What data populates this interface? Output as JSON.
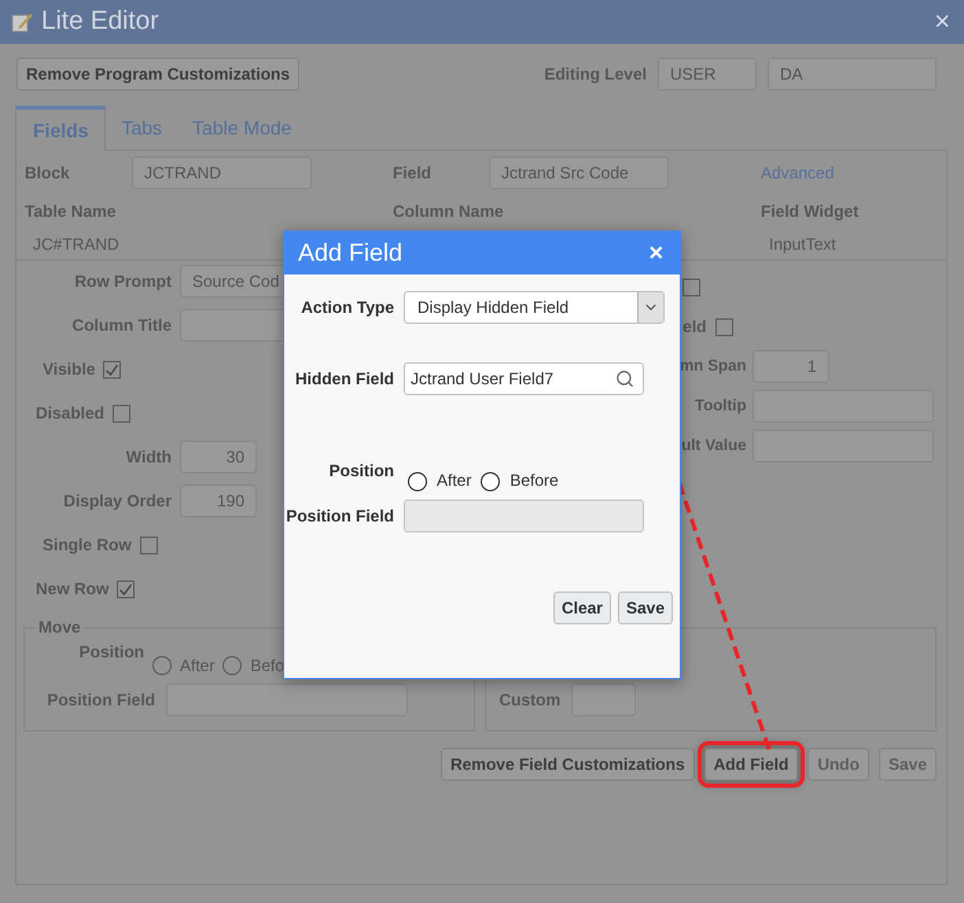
{
  "window": {
    "title": "Lite Editor",
    "close": "×"
  },
  "toolbar": {
    "remove_button": "Remove Program Customizations",
    "editing_level_label": "Editing Level",
    "editing_level": "USER",
    "editing_user": "DA"
  },
  "tabs": [
    {
      "label": "Fields",
      "selected": true
    },
    {
      "label": "Tabs",
      "selected": false
    },
    {
      "label": "Table Mode",
      "selected": false
    }
  ],
  "summary": {
    "block_label": "Block",
    "block": "JCTRAND",
    "field_label": "Field",
    "field": "Jctrand Src Code",
    "advanced_link": "Advanced",
    "table_name_label": "Table Name",
    "table_name": "JC#TRAND",
    "column_name_label": "Column Name",
    "field_widget_label": "Field Widget",
    "field_widget": "InputText"
  },
  "left_form": [
    {
      "kind": "text",
      "label": "Row Prompt",
      "value": "Source Cod"
    },
    {
      "kind": "text",
      "label": "Column Title"
    },
    {
      "kind": "checkbox",
      "label": "Visible",
      "checked": true
    },
    {
      "kind": "checkbox",
      "label": "Disabled",
      "checked": false
    },
    {
      "kind": "number",
      "label": "Width",
      "value": "30"
    },
    {
      "kind": "number",
      "label": "Display Order",
      "value": "190"
    },
    {
      "kind": "checkbox",
      "label": "Single Row",
      "checked": false
    },
    {
      "kind": "checkbox",
      "label": "New Row",
      "checked": true
    }
  ],
  "move": {
    "legend": "Move",
    "position_label": "Position",
    "options": [
      {
        "label": "After",
        "selected": false
      },
      {
        "label": "Befo",
        "selected": false
      }
    ],
    "position_field_label": "Position Field"
  },
  "right_form": [
    {
      "kind": "checkbox",
      "checked": false
    },
    {
      "kind": "checkbox",
      "label": "eld",
      "checked": false
    },
    {
      "kind": "number",
      "label": "mn Span",
      "value": "1"
    },
    {
      "kind": "text",
      "label": "Tooltip"
    },
    {
      "kind": "text",
      "label": "ult Value"
    }
  ],
  "custom": {
    "label": "Custom"
  },
  "actions": [
    {
      "label": "Remove Field Customizations",
      "disabled": false,
      "highlighted": false
    },
    {
      "label": "Add Field",
      "disabled": false,
      "highlighted": true
    },
    {
      "label": "Undo",
      "disabled": true,
      "highlighted": false
    },
    {
      "label": "Save",
      "disabled": true,
      "highlighted": false
    }
  ],
  "dialog": {
    "title": "Add Field",
    "close": "×",
    "action_type_label": "Action Type",
    "action_type": "Display Hidden Field",
    "hidden_field_label": "Hidden Field",
    "hidden_field": "Jctrand User Field7",
    "position_label": "Position",
    "position_options": [
      {
        "label": "After",
        "selected": false
      },
      {
        "label": "Before",
        "selected": false
      }
    ],
    "position_field_label": "Position Field",
    "buttons": [
      "Clear",
      "Save"
    ]
  }
}
